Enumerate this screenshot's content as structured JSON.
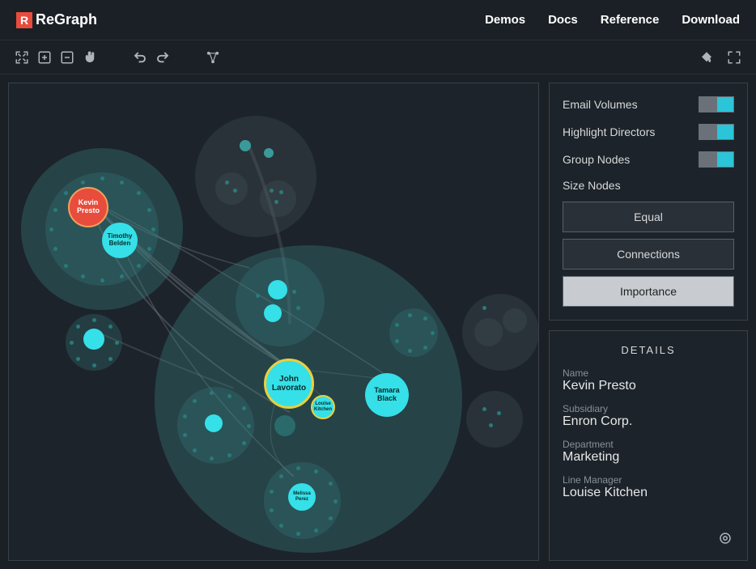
{
  "header": {
    "brand": "ReGraph",
    "logo_glyph": "R",
    "nav": [
      "Demos",
      "Docs",
      "Reference",
      "Download"
    ]
  },
  "toolbar": {
    "fit": "fit-view",
    "zoom_in": "zoom-in",
    "zoom_out": "zoom-out",
    "pan": "pan",
    "undo": "undo",
    "redo": "redo",
    "layout": "layout",
    "fill": "fill",
    "fullscreen": "fullscreen"
  },
  "options": {
    "email_volumes": {
      "label": "Email Volumes",
      "on": true
    },
    "highlight_directors": {
      "label": "Highlight Directors",
      "on": true
    },
    "group_nodes": {
      "label": "Group Nodes",
      "on": true
    },
    "size_nodes": {
      "label": "Size Nodes",
      "buttons": [
        "Equal",
        "Connections",
        "Importance"
      ],
      "active": "Importance"
    }
  },
  "details": {
    "title": "DETAILS",
    "fields": [
      {
        "label": "Name",
        "value": "Kevin Presto"
      },
      {
        "label": "Subsidiary",
        "value": "Enron Corp."
      },
      {
        "label": "Department",
        "value": "Marketing"
      },
      {
        "label": "Line Manager",
        "value": "Louise Kitchen"
      }
    ]
  },
  "graph": {
    "nodes": {
      "kevin_presto": "Kevin Presto",
      "timothy_belden": "Timothy Belden",
      "john_lavorato": "John Lavorato",
      "louise_kitchen": "Louise Kitchen",
      "tamara_black": "Tamara Black",
      "melissa_perez": "Melissa Perez"
    }
  }
}
